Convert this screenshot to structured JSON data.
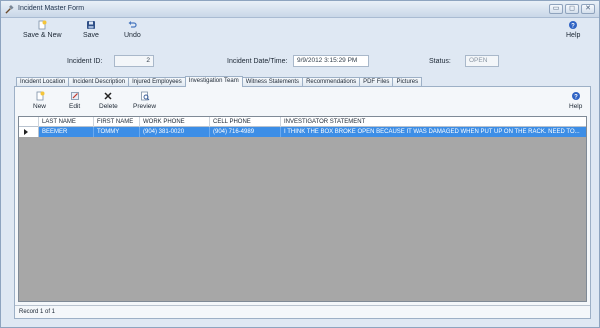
{
  "window": {
    "title": "Incident Master Form"
  },
  "toolbar": {
    "save_new_label": "Save & New",
    "save_label": "Save",
    "undo_label": "Undo",
    "help_label": "Help"
  },
  "fields": {
    "incident_id_label": "Incident ID:",
    "incident_id_value": "2",
    "incident_datetime_label": "Incident Date/Time:",
    "incident_datetime_value": "9/9/2012 3:15:29 PM",
    "status_label": "Status:",
    "status_value": "OPEN"
  },
  "tabs": [
    {
      "label": "Incident Location"
    },
    {
      "label": "Incident Description"
    },
    {
      "label": "Injured Employees"
    },
    {
      "label": "Investigation Team"
    },
    {
      "label": "Witness Statements"
    },
    {
      "label": "Recommendations"
    },
    {
      "label": "PDF Files"
    },
    {
      "label": "Pictures"
    }
  ],
  "panel_toolbar": {
    "new_label": "New",
    "edit_label": "Edit",
    "delete_label": "Delete",
    "preview_label": "Preview",
    "help_label": "Help"
  },
  "grid": {
    "columns": [
      "LAST NAME",
      "FIRST NAME",
      "WORK PHONE",
      "CELL PHONE",
      "INVESTIGATOR STATEMENT"
    ],
    "rows": [
      {
        "last_name": "BEEMER",
        "first_name": "TOMMY",
        "work_phone": "(904) 381-0020",
        "cell_phone": "(904) 716-4989",
        "statement": "I THINK THE BOX BROKE OPEN BECAUSE IT WAS DAMAGED WHEN PUT UP ON THE RACK.  NEED TO..."
      }
    ]
  },
  "status_bar": {
    "text": "Record 1 of 1"
  },
  "colors": {
    "selected_row": "#3d8ee6",
    "grid_background": "#a7a7a7"
  }
}
